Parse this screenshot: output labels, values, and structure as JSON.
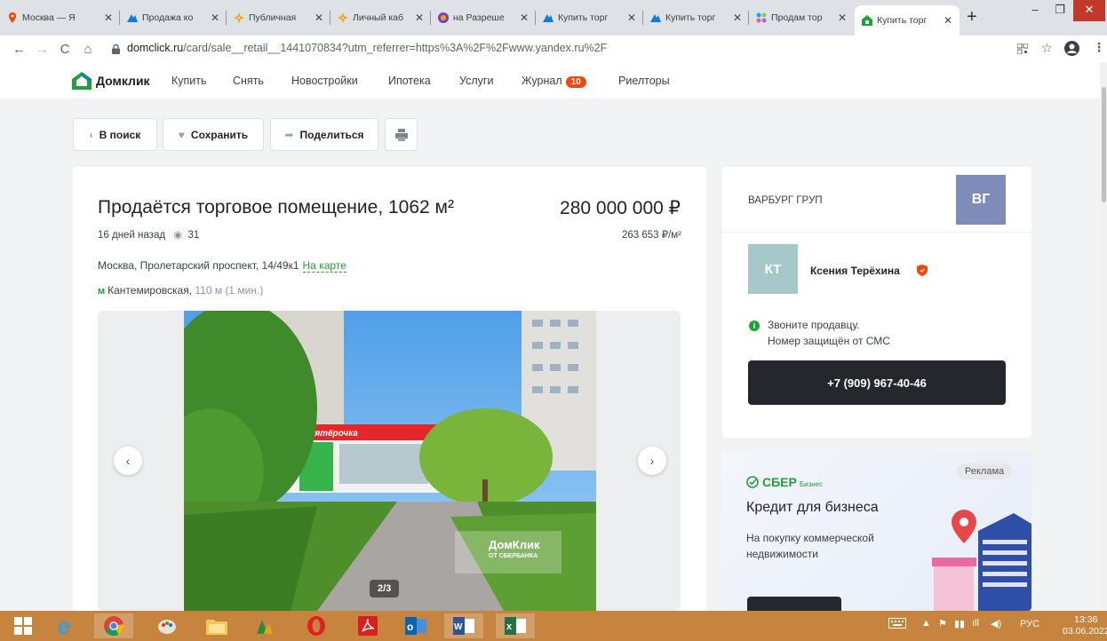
{
  "browser": {
    "tabs": [
      {
        "title": "Москва — Я",
        "favicon_color": "#ff3d00",
        "icon": "map-pin-icon"
      },
      {
        "title": "Продажа ко",
        "favicon_color": "#0a7cdc",
        "icon": "cian-icon"
      },
      {
        "title": "Публичная",
        "favicon_color": "#f2a516",
        "icon": "rosreestr-icon"
      },
      {
        "title": "Личный каб",
        "favicon_color": "#f2a516",
        "icon": "rosreestr-icon"
      },
      {
        "title": "на Разреше",
        "favicon_color": "#7b3fb8",
        "icon": "site-icon"
      },
      {
        "title": "Купить торг",
        "favicon_color": "#0a7cdc",
        "icon": "cian-icon"
      },
      {
        "title": "Купить торг",
        "favicon_color": "#0a7cdc",
        "icon": "cian-icon"
      },
      {
        "title": "Продам тор",
        "favicon_color": "#e8b117",
        "icon": "avito-icon"
      },
      {
        "title": "Купить торг",
        "favicon_color": "#21a038",
        "icon": "domclick-icon",
        "active": true
      }
    ],
    "url_host": "domclick.ru",
    "url_path": "/card/sale__retail__1441070834?utm_referrer=https%3A%2F%2Fwww.yandex.ru%2F"
  },
  "site": {
    "logo": "Домклик",
    "nav": [
      "Купить",
      "Снять",
      "Новостройки",
      "Ипотека",
      "Услуги",
      "Журнал",
      "Риелторы"
    ],
    "journal_badge": "10"
  },
  "actions": {
    "back": "В поиск",
    "save": "Сохранить",
    "share": "Поделиться"
  },
  "listing": {
    "title": "Продаётся торговое помещение, 1062 м²",
    "price": "280 000 000 ₽",
    "posted": "16 дней назад",
    "views": "31",
    "price_per_m2": "263 653 ₽/м²",
    "address": "Москва, Пролетарский проспект, 14/49к1",
    "map_link": "На карте",
    "metro": "Кантемировская,",
    "metro_distance": "110 м (1 мин.)",
    "photo_counter": "2/3",
    "watermark": "ДомКлик",
    "watermark_sub": "ОТ СБЕРБАНКА",
    "store_sign": "Пятёрочка"
  },
  "agent": {
    "agency": "ВАРБУРГ ГРУП",
    "agency_initials": "ВГ",
    "initials": "КТ",
    "name": "Ксения Терёхина",
    "info_line1": "Звоните продавцу.",
    "info_line2": "Номер защищён от СМС",
    "phone": "+7 (909) 967-40-46"
  },
  "ad": {
    "tag": "Реклама",
    "brand": "СБЕР",
    "brand_sub": "Бизнес",
    "title": "Кредит для бизнеса",
    "text_line1": "На покупку коммерческой",
    "text_line2": "недвижимости"
  },
  "system": {
    "lang": "РУС",
    "time": "13:36",
    "date": "03.06.2022"
  }
}
